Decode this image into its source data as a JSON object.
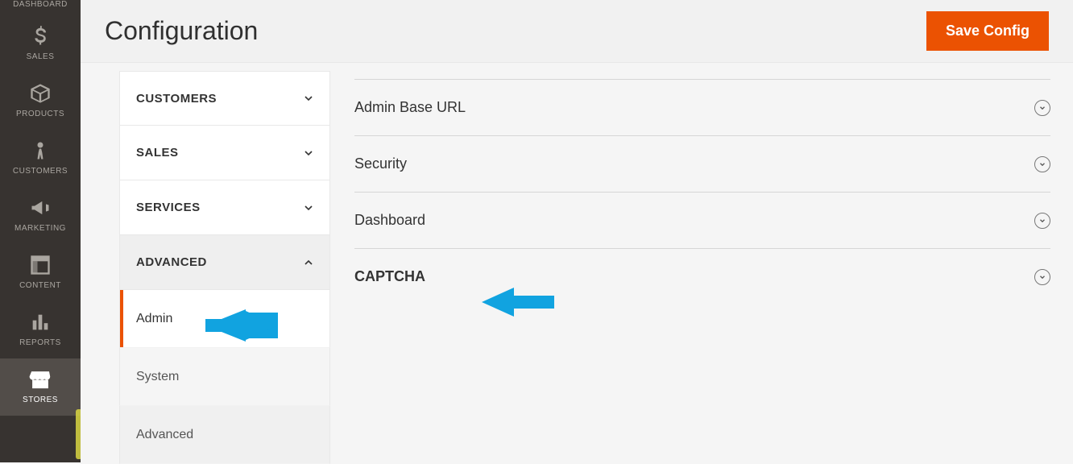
{
  "colors": {
    "accent": "#eb5202",
    "annotation": "#11a3e0",
    "sidebar_bg": "#373330"
  },
  "leftnav": {
    "items": [
      {
        "id": "dashboard",
        "label": "DASHBOARD",
        "icon": "gauge-icon"
      },
      {
        "id": "sales",
        "label": "SALES",
        "icon": "dollar-icon"
      },
      {
        "id": "products",
        "label": "PRODUCTS",
        "icon": "box-icon"
      },
      {
        "id": "customers",
        "label": "CUSTOMERS",
        "icon": "person-icon"
      },
      {
        "id": "marketing",
        "label": "MARKETING",
        "icon": "megaphone-icon"
      },
      {
        "id": "content",
        "label": "CONTENT",
        "icon": "layout-icon"
      },
      {
        "id": "reports",
        "label": "REPORTS",
        "icon": "bars-icon"
      },
      {
        "id": "stores",
        "label": "STORES",
        "icon": "store-icon",
        "active": true
      }
    ]
  },
  "header": {
    "title": "Configuration",
    "save_label": "Save Config"
  },
  "config_tabs": {
    "groups": [
      {
        "label": "CUSTOMERS",
        "expanded": false
      },
      {
        "label": "SALES",
        "expanded": false
      },
      {
        "label": "SERVICES",
        "expanded": false
      },
      {
        "label": "ADVANCED",
        "expanded": true,
        "children": [
          {
            "label": "Admin",
            "active": true
          },
          {
            "label": "System",
            "active": false
          },
          {
            "label": "Advanced",
            "active": false
          }
        ]
      }
    ]
  },
  "sections": [
    {
      "label": "Admin Base URL",
      "bold": false
    },
    {
      "label": "Security",
      "bold": false
    },
    {
      "label": "Dashboard",
      "bold": false
    },
    {
      "label": "CAPTCHA",
      "bold": true
    }
  ],
  "annotations": [
    {
      "id": "arrow-to-admin-tab",
      "points_to": "config-tab-admin"
    },
    {
      "id": "arrow-to-captcha-sec",
      "points_to": "section-captcha"
    }
  ]
}
